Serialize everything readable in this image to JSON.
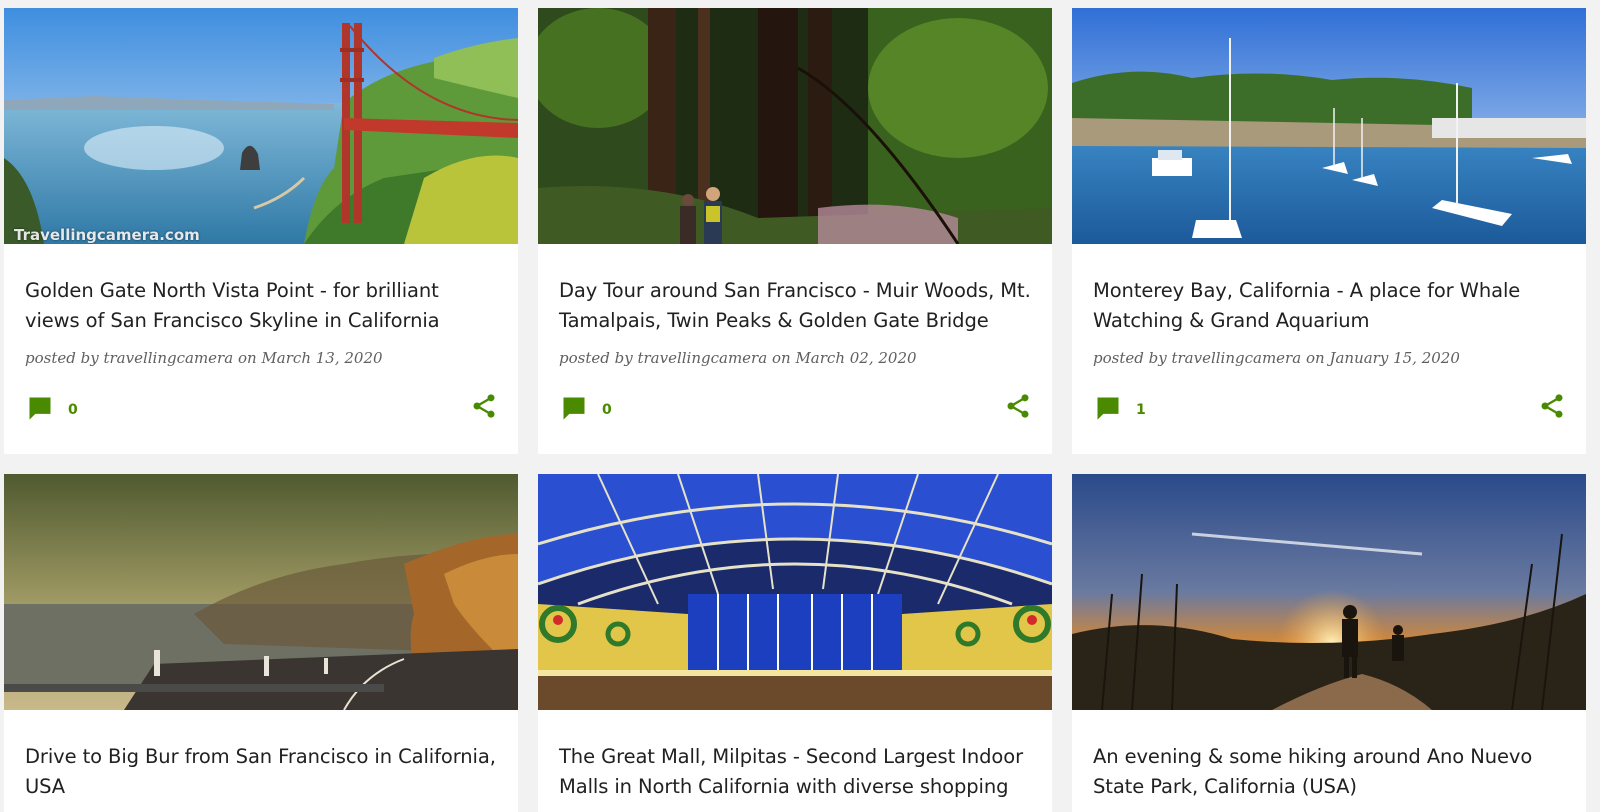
{
  "accent_color": "#4a8a00",
  "posts": [
    {
      "title": "Golden Gate North Vista Point - for brilliant views of San Francisco Skyline in California",
      "posted_by": "posted by",
      "author": "travellingcamera",
      "on": "on",
      "date": "March 13, 2020",
      "comments": "0",
      "watermark": "Travellingcamera.com",
      "image": "golden-gate-bridge-photo"
    },
    {
      "title": "Day Tour around San Francisco - Muir Woods, Mt. Tamalpais, Twin Peaks & Golden Gate Bridge",
      "posted_by": "posted by",
      "author": "travellingcamera",
      "on": "on",
      "date": "March 02, 2020",
      "comments": "0",
      "image": "muir-woods-forest-photo"
    },
    {
      "title": "Monterey Bay, California - A place for Whale Watching & Grand Aquarium",
      "posted_by": "posted by",
      "author": "travellingcamera",
      "on": "on",
      "date": "January 15, 2020",
      "comments": "1",
      "image": "monterey-bay-harbor-photo"
    },
    {
      "title": "Drive to Big Bur from San Francisco in California, USA",
      "image": "big-sur-coast-photo"
    },
    {
      "title": "The Great Mall, Milpitas - Second Largest Indoor Malls in North California with diverse shopping",
      "image": "great-mall-interior-photo"
    },
    {
      "title": "An evening & some hiking around Ano Nuevo State Park, California (USA)",
      "image": "ano-nuevo-sunset-photo"
    }
  ]
}
